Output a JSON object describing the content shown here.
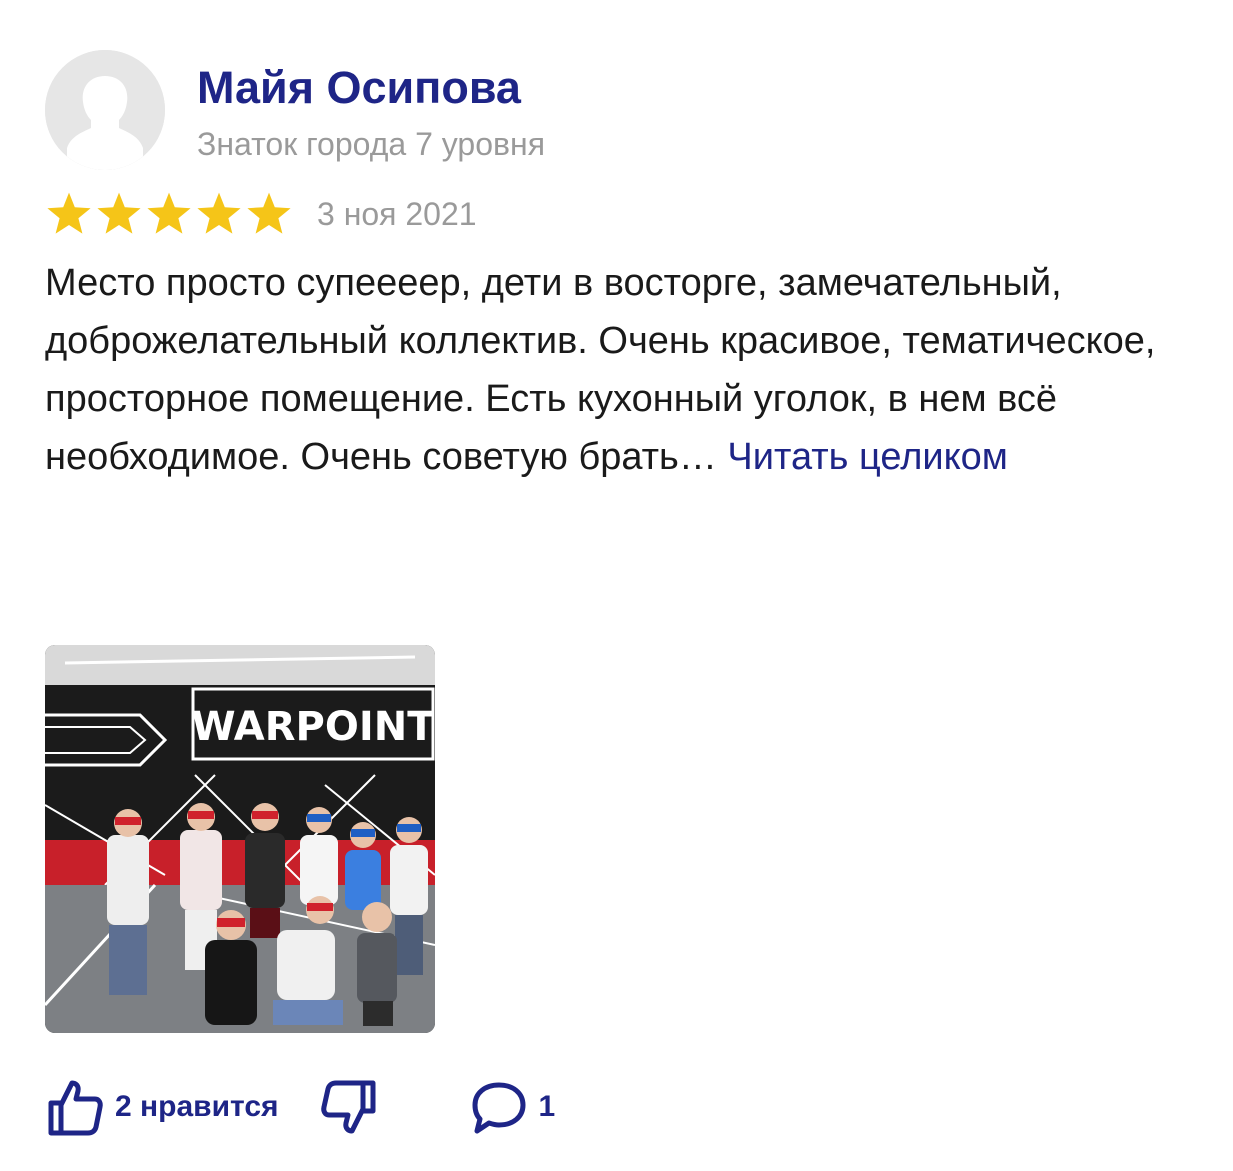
{
  "review": {
    "author": {
      "name": "Майя Осипова",
      "level": "Знаток города 7 уровня"
    },
    "rating": 5,
    "rating_max": 5,
    "date": "3 ноя 2021",
    "text": "Место просто супеееер, дети в восторге, замечательный, доброжелательный коллектив. Очень красивое, тематическое, просторное помещение. Есть кухонный уголок, в нем всё необходимое. Очень советую брать…",
    "read_more_label": "Читать целиком",
    "photo": {
      "sign_text": "WARPOINT"
    },
    "actions": {
      "likes_label": "2 нравится",
      "comments_count": "1"
    }
  },
  "colors": {
    "accent": "#1e2587",
    "star": "#f5c518",
    "muted": "#9a9a9a",
    "text": "#1a1a1a"
  },
  "icons": {
    "avatar": "user-silhouette-icon",
    "star": "star-icon",
    "like": "thumbs-up-icon",
    "dislike": "thumbs-down-icon",
    "comment": "comment-bubble-icon"
  }
}
